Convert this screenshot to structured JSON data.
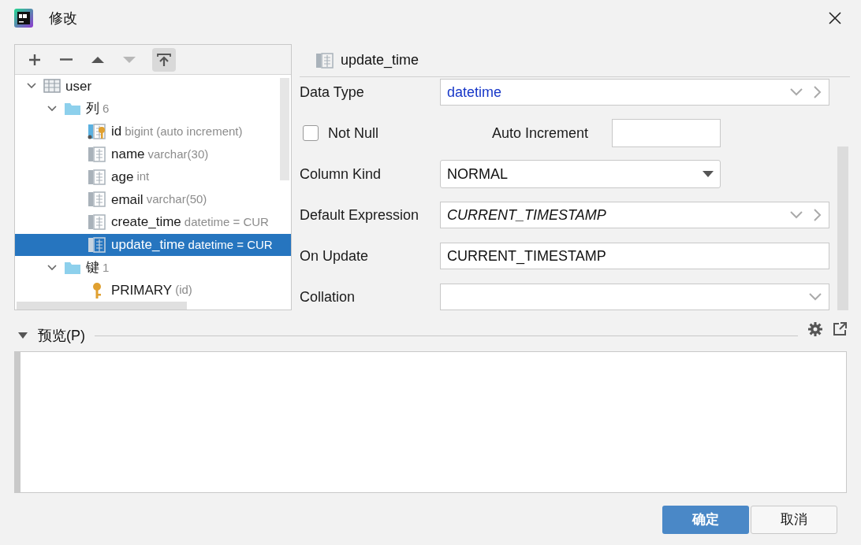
{
  "window": {
    "title": "修改"
  },
  "toolbar": [
    {
      "kind": "add",
      "disabled": false,
      "selected": false
    },
    {
      "kind": "remove",
      "disabled": false,
      "selected": false
    },
    {
      "kind": "up",
      "disabled": false,
      "selected": false
    },
    {
      "kind": "down",
      "disabled": true,
      "selected": false
    },
    {
      "kind": "pin",
      "disabled": false,
      "selected": true
    }
  ],
  "tree": [
    {
      "kind": "table",
      "name": "user",
      "expanded": true,
      "selected": false,
      "children": [
        {
          "kind": "folder",
          "name": "列",
          "detail": "6",
          "expanded": true,
          "selected": false,
          "children": [
            {
              "kind": "pk-column",
              "name": "id",
              "detail": "bigint (auto increment)",
              "selected": false
            },
            {
              "kind": "column",
              "name": "name",
              "detail": "varchar(30)",
              "selected": false
            },
            {
              "kind": "column",
              "name": "age",
              "detail": "int",
              "selected": false
            },
            {
              "kind": "column",
              "name": "email",
              "detail": "varchar(50)",
              "selected": false
            },
            {
              "kind": "column",
              "name": "create_time",
              "detail": "datetime = CUR",
              "selected": false
            },
            {
              "kind": "column",
              "name": "update_time",
              "detail": "datetime = CUR",
              "selected": true
            }
          ]
        },
        {
          "kind": "folder",
          "name": "键",
          "detail": "1",
          "expanded": true,
          "selected": false,
          "children": [
            {
              "kind": "key",
              "name": "PRIMARY",
              "detail": "(id)",
              "selected": false
            }
          ]
        }
      ]
    }
  ],
  "editor": {
    "title": "update_time",
    "fields": [
      {
        "kind": "type-combo",
        "label": "Data Type",
        "value": "datetime"
      },
      {
        "kind": "checkbox-row",
        "label": "Not Null",
        "checked": false,
        "extra_label": "Auto Increment"
      },
      {
        "kind": "dropdown",
        "label": "Column Kind",
        "value": "NORMAL"
      },
      {
        "kind": "expression-combo",
        "label": "Default Expression",
        "value": "CURRENT_TIMESTAMP"
      },
      {
        "kind": "text",
        "label": "On Update",
        "value": "CURRENT_TIMESTAMP"
      },
      {
        "kind": "combo",
        "label": "Collation"
      }
    ]
  },
  "preview": {
    "title": "预览(P)",
    "expanded": true
  },
  "buttons": [
    {
      "label": "确定",
      "default": true
    },
    {
      "label": "取消",
      "default": false
    }
  ]
}
